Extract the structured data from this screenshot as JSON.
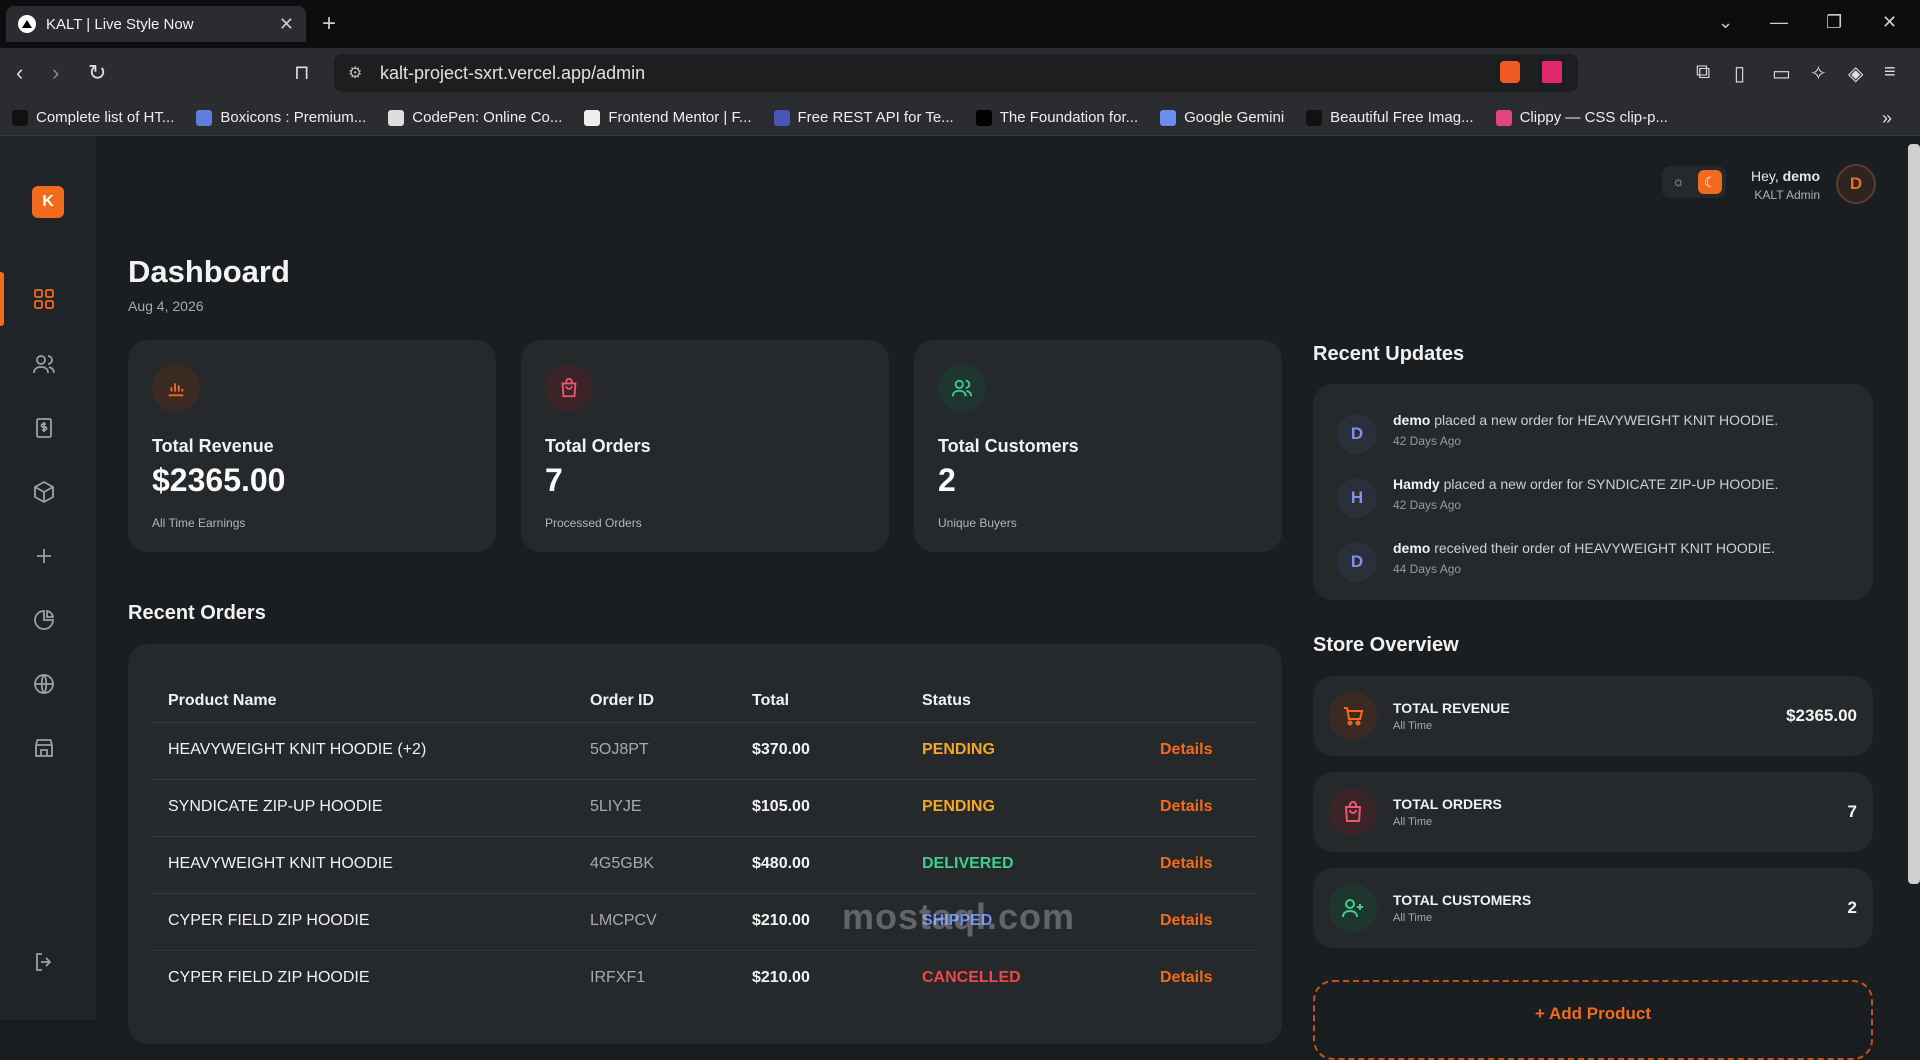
{
  "browser": {
    "tab_title": "KALT | Live Style Now",
    "url": "kalt-project-sxrt.vercel.app/admin",
    "bookmarks": [
      {
        "label": "Complete list of HT...",
        "color": "#111111"
      },
      {
        "label": "Boxicons : Premium...",
        "color": "#5b7fdd"
      },
      {
        "label": "CodePen: Online Co...",
        "color": "#dddddd"
      },
      {
        "label": "Frontend Mentor | F...",
        "color": "#eeeeee"
      },
      {
        "label": "Free REST API for Te...",
        "color": "#4a56b5"
      },
      {
        "label": "The Foundation for...",
        "color": "#000000"
      },
      {
        "label": "Google Gemini",
        "color": "#6a8ef0"
      },
      {
        "label": "Beautiful Free Imag...",
        "color": "#111111"
      },
      {
        "label": "Clippy — CSS clip-p...",
        "color": "#e0467c"
      }
    ]
  },
  "sidebar": {
    "logo": "K",
    "icons": [
      "dashboard-icon",
      "users-icon",
      "receipt-icon",
      "box-icon",
      "plus-icon",
      "pie-chart-icon",
      "globe-icon",
      "store-icon"
    ],
    "logout_icon": "logout-icon"
  },
  "header": {
    "greeting": "Hey,",
    "username": "demo",
    "role": "KALT Admin",
    "avatar": "D"
  },
  "page": {
    "title": "Dashboard",
    "date": "Aug 4, 2026"
  },
  "stats": [
    {
      "label": "Total Revenue",
      "value": "$2365.00",
      "sub": "All Time Earnings",
      "icon": "bar-chart-icon",
      "color": "#f26a1b"
    },
    {
      "label": "Total Orders",
      "value": "7",
      "sub": "Processed Orders",
      "icon": "shopping-bag-icon",
      "color": "#f0566b"
    },
    {
      "label": "Total Customers",
      "value": "2",
      "sub": "Unique Buyers",
      "icon": "users-icon",
      "color": "#3ecf8e"
    }
  ],
  "orders": {
    "title": "Recent Orders",
    "headers": [
      "Product Name",
      "Order ID",
      "Total",
      "Status"
    ],
    "details_label": "Details",
    "rows": [
      {
        "name": "HEAVYWEIGHT KNIT HOODIE (+2)",
        "id": "5OJ8PT",
        "total": "$370.00",
        "status": "PENDING",
        "color": "#f5a623"
      },
      {
        "name": "SYNDICATE ZIP-UP HOODIE",
        "id": "5LIYJE",
        "total": "$105.00",
        "status": "PENDING",
        "color": "#f5a623"
      },
      {
        "name": "HEAVYWEIGHT KNIT HOODIE",
        "id": "4G5GBK",
        "total": "$480.00",
        "status": "DELIVERED",
        "color": "#3ecf8e"
      },
      {
        "name": "CYPER FIELD ZIP HOODIE",
        "id": "LMCPCV",
        "total": "$210.00",
        "status": "SHIPPED",
        "color": "#6f8ef5"
      },
      {
        "name": "CYPER FIELD ZIP HOODIE",
        "id": "IRFXF1",
        "total": "$210.00",
        "status": "CANCELLED",
        "color": "#f04646"
      }
    ]
  },
  "updates": {
    "title": "Recent Updates",
    "items": [
      {
        "avatar": "D",
        "user": "demo",
        "text": " placed a new order for HEAVYWEIGHT KNIT HOODIE.",
        "ago": "42 Days Ago"
      },
      {
        "avatar": "H",
        "user": "Hamdy",
        "text": " placed a new order for SYNDICATE ZIP-UP HOODIE.",
        "ago": "42 Days Ago"
      },
      {
        "avatar": "D",
        "user": "demo",
        "text": " received their order of HEAVYWEIGHT KNIT HOODIE.",
        "ago": "44 Days Ago"
      }
    ]
  },
  "overview": {
    "title": "Store Overview",
    "items": [
      {
        "title": "TOTAL REVENUE",
        "sub": "All Time",
        "value": "$2365.00",
        "icon": "cart-icon",
        "color": "#f26a1b"
      },
      {
        "title": "TOTAL ORDERS",
        "sub": "All Time",
        "value": "7",
        "icon": "shopping-bag-icon",
        "color": "#f0566b"
      },
      {
        "title": "TOTAL CUSTOMERS",
        "sub": "All Time",
        "value": "2",
        "icon": "user-plus-icon",
        "color": "#3ecf8e"
      }
    ],
    "add_label": "+ Add Product"
  },
  "watermark": "mostaql.com"
}
